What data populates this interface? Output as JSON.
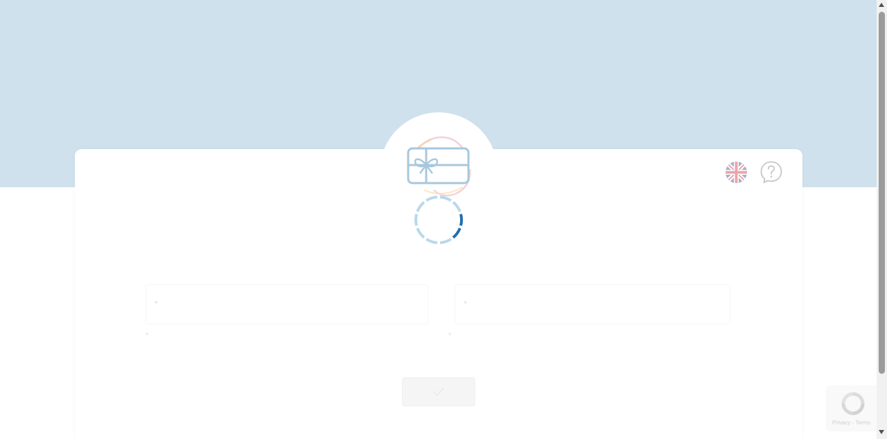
{
  "form": {
    "first_field": {
      "required_mark": "*",
      "value": "",
      "hint": "*"
    },
    "second_field": {
      "required_mark": "*",
      "value": "",
      "hint": "*"
    },
    "submit_button": {
      "icon": "check-icon"
    }
  },
  "header": {
    "language_icon": "uk-flag-icon",
    "help_icon": "question-bubble-icon"
  },
  "hero": {
    "icon": "gift-card-icon",
    "loading_icon": "loading-spinner-icon",
    "loading_progress": 0.2
  },
  "recaptcha": {
    "links": "Privacy - Terms"
  },
  "colors": {
    "hero_band": "#cfe1ec",
    "spinner_track": "#b9d8ea",
    "spinner_active": "#1e6fb0",
    "icon_stroke": "#a8c7dd"
  }
}
